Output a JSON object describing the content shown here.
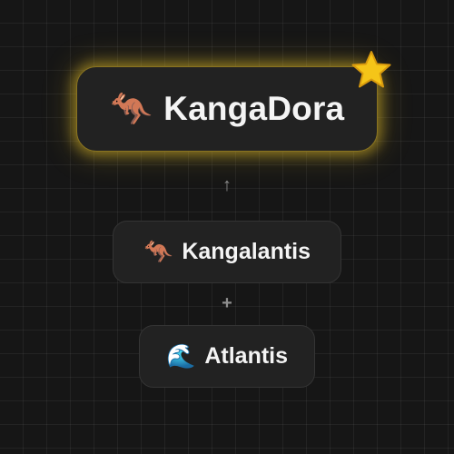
{
  "result": {
    "emoji": "🦘",
    "label": "KangaDora",
    "is_new_discovery": true,
    "star_icon": "star-icon",
    "glow_color": "#d6b228"
  },
  "combine_arrow": "↑",
  "combine_plus": "+",
  "ingredients": [
    {
      "emoji": "🦘",
      "label": "Kangalantis"
    },
    {
      "emoji": "🌊",
      "label": "Atlantis"
    }
  ],
  "colors": {
    "background": "#161616",
    "card": "#222222",
    "text": "#f4f4f4",
    "star": "#f5c518"
  }
}
